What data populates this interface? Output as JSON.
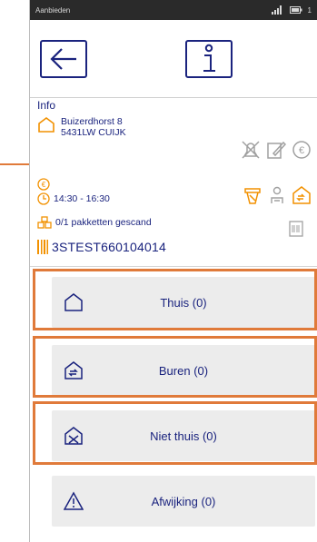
{
  "statusbar": {
    "carrier": "Aanbieden",
    "time": "1"
  },
  "appbar": {
    "back_icon": "arrow-left-icon",
    "info_icon": "info-icon"
  },
  "info": {
    "heading": "Info",
    "address_line1": "Buizerdhorst 8",
    "address_line2": "5431LW CUIJK",
    "currency_symbol": "€",
    "time_window": "14:30 - 16:30",
    "packages": "0/1 pakketten gescand",
    "barcode": "3STEST660104014"
  },
  "actions": [
    {
      "label": "Thuis (0)",
      "icon": "home-icon"
    },
    {
      "label": "Buren (0)",
      "icon": "neighbor-home-icon"
    },
    {
      "label": "Niet thuis (0)",
      "icon": "not-home-icon"
    },
    {
      "label": "Afwijking (0)",
      "icon": "warning-icon"
    }
  ],
  "colors": {
    "primary": "#1a237e",
    "accent": "#f29100",
    "highlight": "#e07a3a",
    "button_bg": "#ececec"
  }
}
